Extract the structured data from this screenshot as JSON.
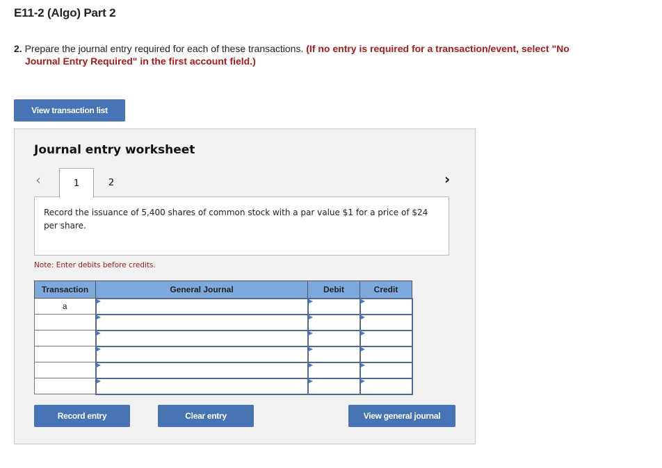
{
  "page": {
    "title": "E11-2 (Algo) Part 2",
    "instruction_number": "2.",
    "instruction_text": "Prepare the journal entry required for each of these transactions.",
    "instruction_note_line1": "(If no entry is required for a transaction/event, select \"No",
    "instruction_note_line2": "Journal Entry Required\" in the first account field.)"
  },
  "buttons": {
    "view_transaction_list": "View transaction list",
    "record_entry": "Record entry",
    "clear_entry": "Clear entry",
    "view_general_journal": "View general journal"
  },
  "worksheet": {
    "title": "Journal entry worksheet",
    "prev_icon": "‹",
    "next_icon": "›",
    "tabs": [
      {
        "label": "1",
        "active": true
      },
      {
        "label": "2",
        "active": false
      }
    ],
    "description": "Record the issuance of 5,400 shares of common stock with a par value $1 for a price of $24 per share.",
    "note": "Note: Enter debits before credits."
  },
  "journal": {
    "headers": {
      "transaction": "Transaction",
      "general_journal": "General Journal",
      "debit": "Debit",
      "credit": "Credit"
    },
    "rows": [
      {
        "transaction": "a",
        "account": "",
        "debit": "",
        "credit": ""
      },
      {
        "transaction": "",
        "account": "",
        "debit": "",
        "credit": ""
      },
      {
        "transaction": "",
        "account": "",
        "debit": "",
        "credit": ""
      },
      {
        "transaction": "",
        "account": "",
        "debit": "",
        "credit": ""
      },
      {
        "transaction": "",
        "account": "",
        "debit": "",
        "credit": ""
      },
      {
        "transaction": "",
        "account": "",
        "debit": "",
        "credit": ""
      }
    ]
  }
}
